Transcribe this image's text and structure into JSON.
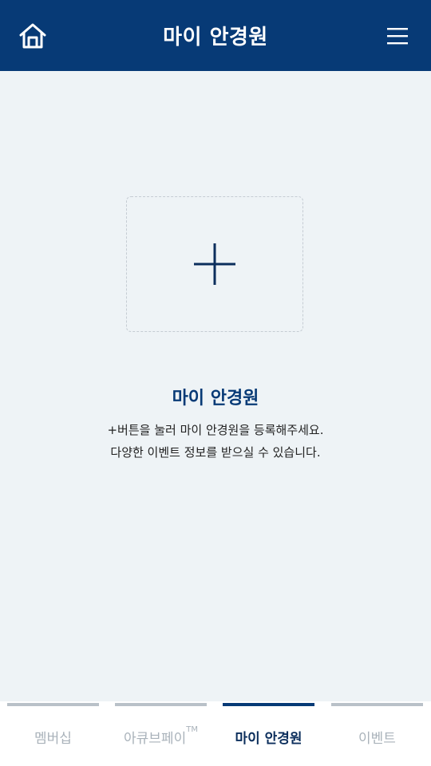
{
  "header": {
    "title": "마이 안경원"
  },
  "empty_state": {
    "title": "마이 안경원",
    "line1": "+버튼을 눌러 마이 안경원을 등록해주세요.",
    "line2": "다양한 이벤트 정보를 받으실 수 있습니다."
  },
  "tabs": [
    {
      "label": "멤버십",
      "active": false
    },
    {
      "label": "아큐브페이",
      "trademark": "TM",
      "active": false
    },
    {
      "label": "마이 안경원",
      "active": true
    },
    {
      "label": "이벤트",
      "active": false
    }
  ],
  "icons": {
    "home": "home-icon",
    "menu": "hamburger-menu-icon",
    "add": "plus-icon"
  },
  "colors": {
    "primary": "#073a76",
    "background": "#eef3f6",
    "inactive_tab": "#a9b2ba"
  }
}
